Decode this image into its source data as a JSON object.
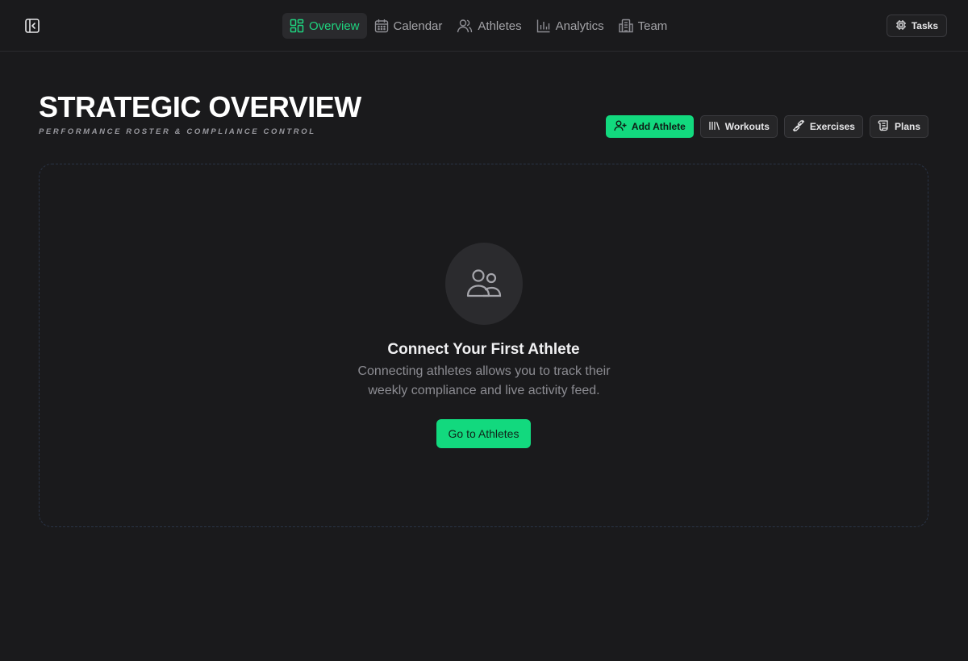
{
  "nav": {
    "items": [
      {
        "label": "Overview",
        "icon": "grid-icon",
        "active": true
      },
      {
        "label": "Calendar",
        "icon": "calendar-icon",
        "active": false
      },
      {
        "label": "Athletes",
        "icon": "users-icon",
        "active": false
      },
      {
        "label": "Analytics",
        "icon": "bar-chart-icon",
        "active": false
      },
      {
        "label": "Team",
        "icon": "building-icon",
        "active": false
      }
    ],
    "tasks_label": "Tasks"
  },
  "header": {
    "title": "STRATEGIC OVERVIEW",
    "subtitle": "PERFORMANCE ROSTER & COMPLIANCE CONTROL"
  },
  "actions": {
    "add_athlete": "Add Athlete",
    "workouts": "Workouts",
    "exercises": "Exercises",
    "plans": "Plans"
  },
  "empty_state": {
    "title": "Connect Your First Athlete",
    "description": "Connecting athletes allows you to track their weekly compliance and live activity feed.",
    "cta": "Go to Athletes"
  },
  "colors": {
    "accent": "#12d97e",
    "background": "#1a1a1c",
    "panel_border": "#2a3446"
  }
}
